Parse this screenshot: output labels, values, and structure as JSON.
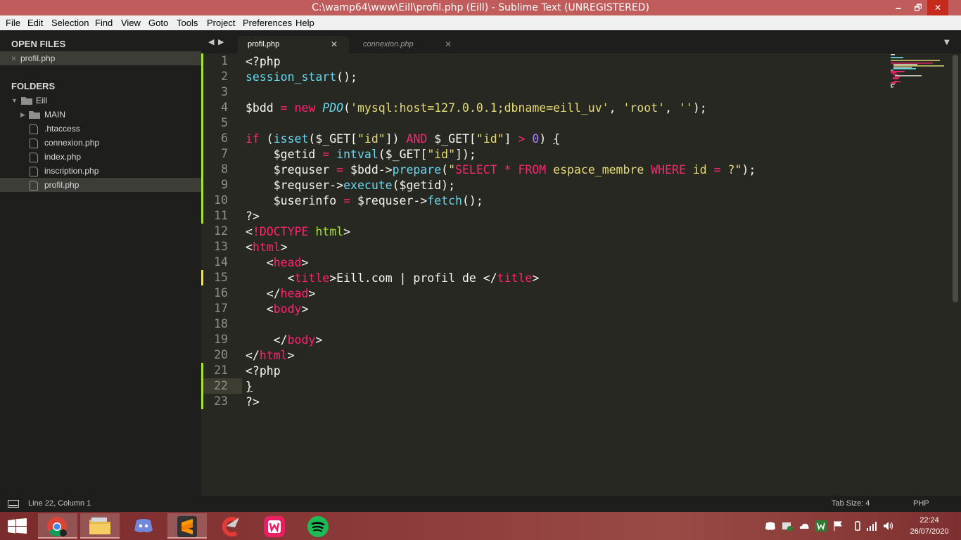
{
  "window": {
    "title": "C:\\wamp64\\www\\Eill\\profil.php (Eill) - Sublime Text (UNREGISTERED)",
    "minimize_label": "🗕",
    "maximize_label": "🗗",
    "close_label": "✕"
  },
  "menu": [
    "File",
    "Edit",
    "Selection",
    "Find",
    "View",
    "Goto",
    "Tools",
    "Project",
    "Preferences",
    "Help"
  ],
  "sidebar": {
    "open_files_heading": "OPEN FILES",
    "open_files": [
      "profil.php"
    ],
    "folders_heading": "FOLDERS",
    "tree": [
      {
        "label": "Eill"
      },
      {
        "label": "MAIN"
      },
      {
        "label": ".htaccess"
      },
      {
        "label": "connexion.php"
      },
      {
        "label": "index.php"
      },
      {
        "label": "inscription.php"
      },
      {
        "label": "profil.php"
      }
    ]
  },
  "tabs": [
    {
      "label": "profil.php"
    },
    {
      "label": "connexion.php"
    }
  ],
  "editor": {
    "line_numbers": [
      "1",
      "2",
      "3",
      "4",
      "5",
      "6",
      "7",
      "8",
      "9",
      "10",
      "11",
      "12",
      "13",
      "14",
      "15",
      "16",
      "17",
      "18",
      "19",
      "20",
      "21",
      "22",
      "23"
    ]
  },
  "status": {
    "position": "Line 22, Column 1",
    "tab_size": "Tab Size: 4",
    "syntax": "PHP"
  },
  "taskbar": {
    "apps": [
      "start-icon",
      "chrome-icon",
      "file-explorer-icon",
      "discord-icon",
      "sublime-text-icon",
      "ccleaner-icon",
      "wamp-server-icon",
      "spotify-icon"
    ],
    "time": "22:24",
    "date": "26/07/2020"
  },
  "colors": {
    "titlebar": "#c05c5c",
    "editor_bg": "#272822",
    "sidebar_bg": "#1e1f1c",
    "keyword": "#f92672",
    "string": "#e6db74",
    "function": "#66d9ef",
    "class": "#a6e22e",
    "number": "#ae81ff"
  }
}
